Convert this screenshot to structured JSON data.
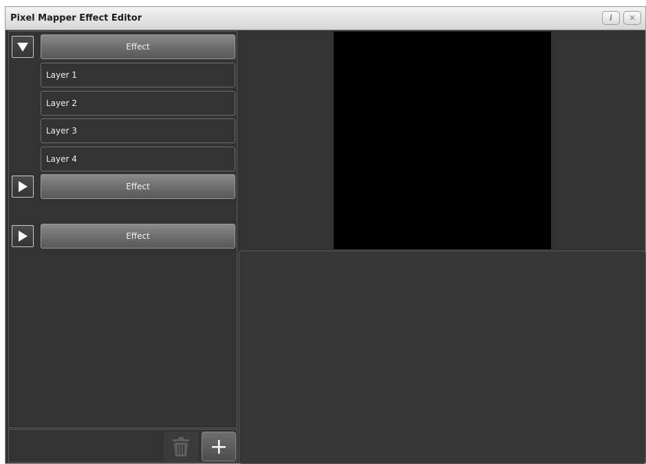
{
  "window": {
    "title": "Pixel Mapper Effect Editor",
    "info_label": "i",
    "close_label": "✕"
  },
  "effects": [
    {
      "label": "Effect",
      "expanded": true,
      "layers": [
        "Layer 1",
        "Layer 2",
        "Layer 3",
        "Layer 4"
      ]
    },
    {
      "label": "Effect",
      "expanded": false,
      "layers": []
    },
    {
      "label": "Effect",
      "expanded": false,
      "layers": []
    }
  ],
  "toolbar": {
    "delete_icon": "trash-icon",
    "add_icon": "plus-icon"
  },
  "colors": {
    "background": "#333333",
    "preview": "#000000",
    "titlebar": "#e2e2e2"
  }
}
